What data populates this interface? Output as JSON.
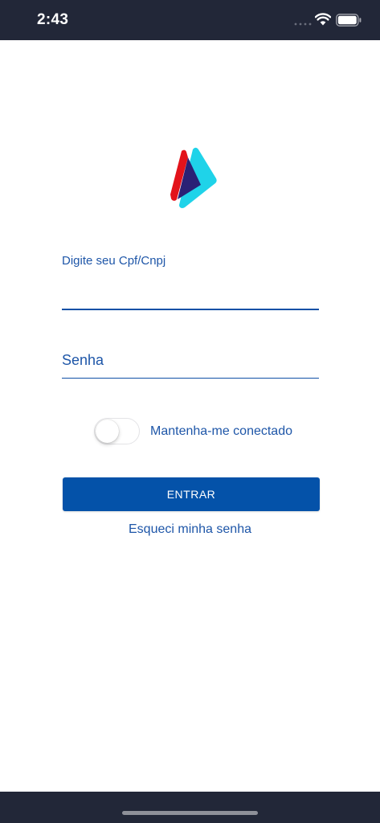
{
  "status_bar": {
    "time": "2:43",
    "signal_icon": "signal-bars-icon",
    "wifi_icon": "wifi-icon",
    "battery_icon": "battery-icon"
  },
  "logo": {
    "icon": "brand-logo-icon",
    "colors": {
      "red": "#e3131b",
      "navy": "#2a2175",
      "cyan": "#1fd3e9"
    }
  },
  "form": {
    "cpf_label": "Digite seu Cpf/Cnpj",
    "cpf_value": "",
    "senha_placeholder": "Senha",
    "senha_value": "",
    "remember_label": "Mantenha-me conectado",
    "remember_on": false,
    "submit_label": "ENTRAR",
    "forgot_label": "Esqueci minha senha"
  },
  "colors": {
    "primary": "#0452a9",
    "text_blue": "#1e56a8",
    "bar_dark": "#222738"
  }
}
